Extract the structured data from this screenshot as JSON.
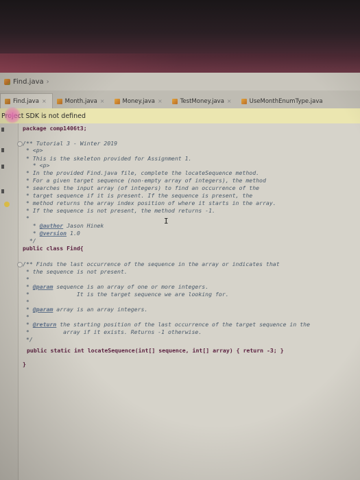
{
  "breadcrumb": {
    "file": "Find.java"
  },
  "tabs": [
    {
      "label": "Find.java",
      "active": true
    },
    {
      "label": "Month.java",
      "active": false
    },
    {
      "label": "Money.java",
      "active": false
    },
    {
      "label": "TestMoney.java",
      "active": false
    },
    {
      "label": "UseMonthEnumType.java",
      "active": false
    }
  ],
  "notice": {
    "text": "Project SDK is not defined"
  },
  "code": {
    "package_kw": "package",
    "package_name": " comp1406t3;",
    "c1": "/** Tutorial 3 - Winter 2019",
    "c2": " * <p>",
    "c3": " * This is the skeleton provided for Assignment 1.",
    "c4": "   * <p>",
    "c5": " * In the provided Find.java file, complete the locateSequence method.",
    "c6": " * For a given target sequence (non-empty array of integers), the method",
    "c7": " * searches the input array (of integers) to find an occurrence of the",
    "c8": " * target sequence if it is present. If the sequence is present, the",
    "c9": " * method returns the array index position of where it starts in the array.",
    "c10": " * If the sequence is not present, the method returns -1.",
    "c11": " *",
    "author_prefix": "   * ",
    "author_tag": "@author",
    "author_name": " Jason Hinek",
    "version_prefix": "   * ",
    "version_tag": "@version",
    "version_val": " 1.0",
    "c_end": "  */",
    "class_decl": "public class Find{",
    "d1": "/** Finds the last occurrence of the sequence in the array or indicates that",
    "d2": " * the sequence is not present.",
    "d3": " *",
    "p1_prefix": " * ",
    "p1_tag": "@param",
    "p1_text": " sequence is an array of one or more integers.",
    "p1b": " *              It is the target sequence we are looking for.",
    "d4": " *",
    "p2_prefix": " * ",
    "p2_tag": "@param",
    "p2_text": " array is an array integers.",
    "d5": " *",
    "r_prefix": " * ",
    "r_tag": "@return",
    "r_text": " the starting position of the last occurrence of the target sequence in the",
    "r_text2": " *          array if it exists. Returns -1 otherwise.",
    "d_end": " */",
    "method_line": "public static int locateSequence(int[] sequence, int[] array) { return -3; }",
    "close_brace": "}"
  },
  "colors": {
    "keyword": "#5a1f3f",
    "comment": "#4a5a6a",
    "doc_tag": "#5b6f8a",
    "notice_bg": "#ebe6b0"
  }
}
